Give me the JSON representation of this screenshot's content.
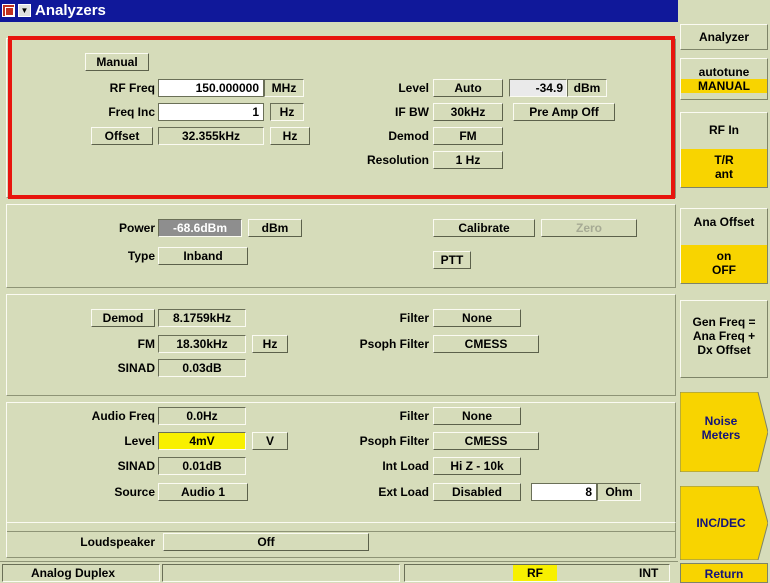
{
  "window": {
    "title": "Analyzers"
  },
  "rf": {
    "mode_button": "Manual",
    "rf_freq_label": "RF Freq",
    "rf_freq_value": "150.000000",
    "rf_freq_unit": "MHz",
    "freq_inc_label": "Freq Inc",
    "freq_inc_value": "1",
    "freq_inc_unit": "Hz",
    "offset_button": "Offset",
    "offset_value": "32.355kHz",
    "offset_unit": "Hz",
    "level_label": "Level",
    "level_mode": "Auto",
    "level_value": "-34.9",
    "level_unit": "dBm",
    "ifbw_label": "IF BW",
    "ifbw_value": "30kHz",
    "preamp_button": "Pre Amp Off",
    "demod_label": "Demod",
    "demod_value": "FM",
    "resolution_label": "Resolution",
    "resolution_value": "1 Hz"
  },
  "power": {
    "power_label": "Power",
    "power_value": "-68.6dBm",
    "power_unit": "dBm",
    "type_label": "Type",
    "type_value": "Inband",
    "calibrate_button": "Calibrate",
    "zero_button": "Zero",
    "ptt_button": "PTT"
  },
  "demod": {
    "demod_button": "Demod",
    "demod_value": "8.1759kHz",
    "fm_label": "FM",
    "fm_value": "18.30kHz",
    "fm_unit": "Hz",
    "sinad_label": "SINAD",
    "sinad_value": "0.03dB",
    "filter_label": "Filter",
    "filter_value": "None",
    "psoph_label": "Psoph Filter",
    "psoph_value": "CMESS"
  },
  "audio": {
    "audio_freq_label": "Audio Freq",
    "audio_freq_value": "0.0Hz",
    "level_label": "Level",
    "level_value": "4mV",
    "level_unit": "V",
    "sinad_label": "SINAD",
    "sinad_value": "0.01dB",
    "source_label": "Source",
    "source_value": "Audio 1",
    "filter_label": "Filter",
    "filter_value": "None",
    "psoph_label": "Psoph Filter",
    "psoph_value": "CMESS",
    "int_load_label": "Int Load",
    "int_load_value": "Hi Z - 10k",
    "ext_load_label": "Ext Load",
    "ext_load_value": "Disabled",
    "ext_load_num": "8",
    "ext_load_unit": "Ohm"
  },
  "loudspeaker": {
    "label": "Loudspeaker",
    "value": "Off"
  },
  "status": {
    "mode": "Analog Duplex",
    "rf": "RF",
    "int": "INT"
  },
  "softkeys": {
    "analyzer": "Analyzer",
    "autotune_title": "autotune",
    "autotune_value": "MANUAL",
    "rf_in_title": "RF In",
    "rf_in_value1": "T/R",
    "rf_in_value2": "ant",
    "ana_offset_title": "Ana Offset",
    "ana_offset_on": "on",
    "ana_offset_off": "OFF",
    "gen_freq_line1": "Gen Freq =",
    "gen_freq_line2": "Ana Freq +",
    "gen_freq_line3": "Dx Offset",
    "noise_line1": "Noise",
    "noise_line2": "Meters",
    "incdec": "INC/DEC",
    "return": "Return"
  },
  "colors": {
    "title_bar": "#10189a",
    "panel": "#d6dcba",
    "highlight_box": "#e8150d",
    "yellow": "#f8f000",
    "softkey_yellow": "#f8d400"
  }
}
